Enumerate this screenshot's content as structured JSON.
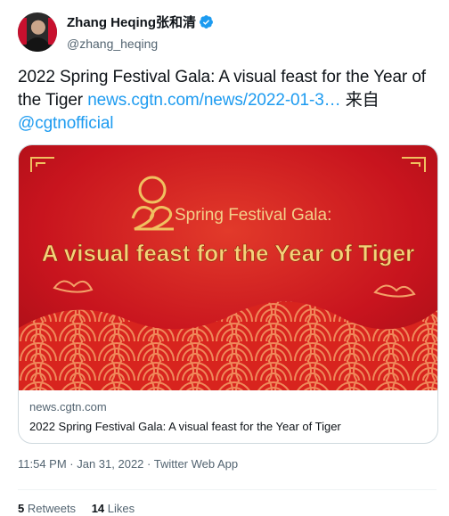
{
  "user": {
    "display_name": "Zhang Heqing张和清",
    "handle": "@zhang_heqing"
  },
  "tweet": {
    "text": "2022 Spring Festival Gala: A visual feast for the Year of the Tiger ",
    "link_text": "news.cgtn.com/news/2022-01-3…",
    "via_text": " 来自",
    "mention": "@cgtnofficial"
  },
  "card": {
    "image_heading": "Spring Festival Gala:",
    "image_title": "A visual feast for the Year of Tiger",
    "domain": "news.cgtn.com",
    "title": "2022 Spring Festival Gala: A visual feast for the Year of Tiger"
  },
  "timestamp": "11:54 PM · Jan 31, 2022 · Twitter Web App",
  "stats": {
    "retweets_count": "5",
    "retweets_label": "Retweets",
    "likes_count": "14",
    "likes_label": "Likes"
  },
  "colors": {
    "link": "#1d9bf0",
    "card_red": "#c8141e",
    "gold": "#f0c060"
  }
}
